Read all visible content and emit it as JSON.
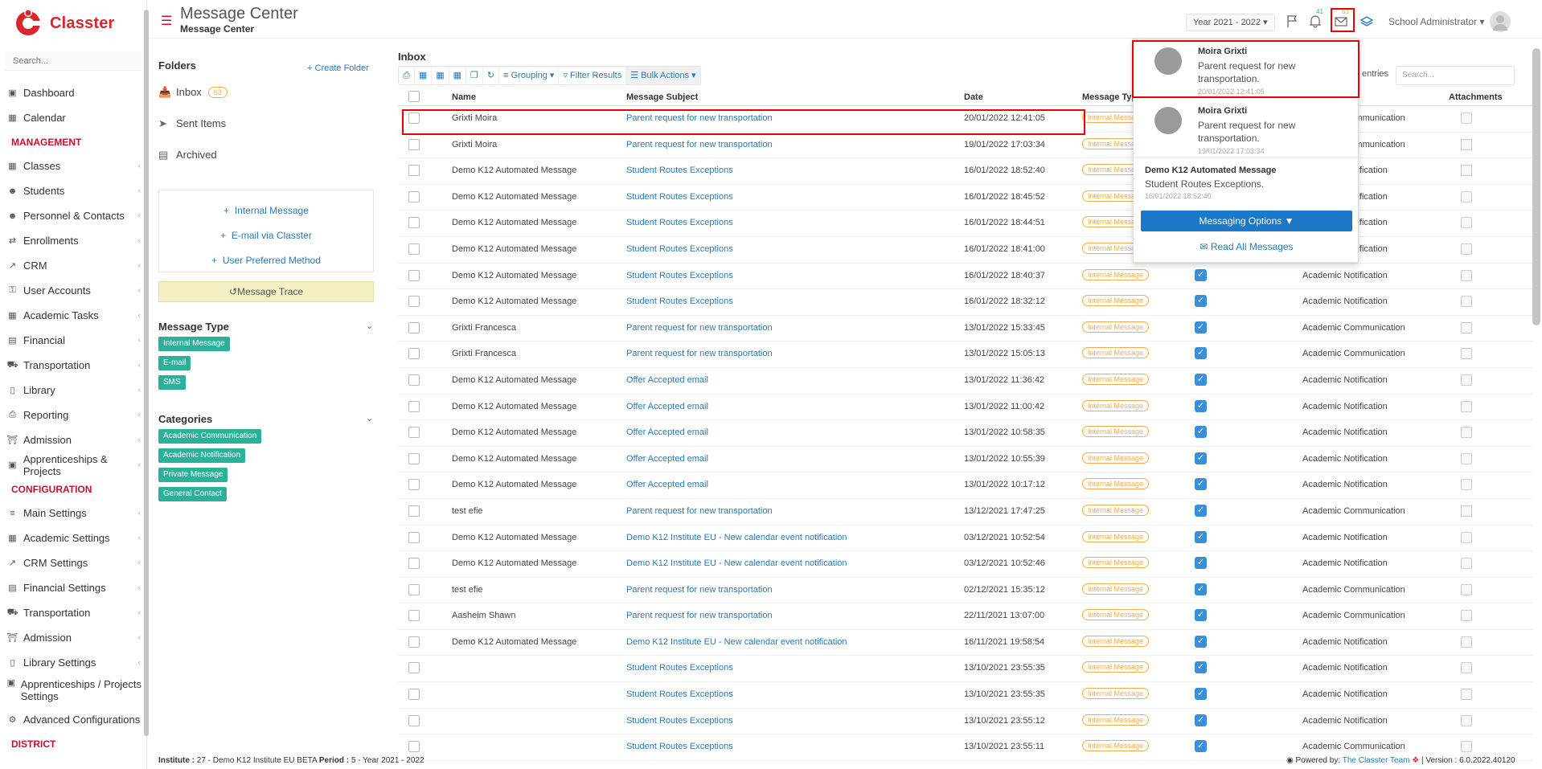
{
  "app": {
    "name": "Classter",
    "brand_color": "#d9262c"
  },
  "sidebar": {
    "search_placeholder": "Search...",
    "items": [
      {
        "type": "item",
        "label": "Dashboard",
        "icon": "laptop-icon"
      },
      {
        "type": "item",
        "label": "Calendar",
        "icon": "calendar-icon"
      },
      {
        "type": "section",
        "label": "MANAGEMENT"
      },
      {
        "type": "item",
        "label": "Classes",
        "icon": "classes-icon",
        "arrow": true
      },
      {
        "type": "item",
        "label": "Students",
        "icon": "students-icon",
        "arrow": true
      },
      {
        "type": "item",
        "label": "Personnel & Contacts",
        "icon": "personnel-icon",
        "arrow": true
      },
      {
        "type": "item",
        "label": "Enrollments",
        "icon": "enrollments-icon",
        "arrow": true
      },
      {
        "type": "item",
        "label": "CRM",
        "icon": "crm-icon",
        "arrow": true
      },
      {
        "type": "item",
        "label": "User Accounts",
        "icon": "key-icon",
        "arrow": true
      },
      {
        "type": "item",
        "label": "Academic Tasks",
        "icon": "tasks-icon",
        "arrow": true
      },
      {
        "type": "item",
        "label": "Financial",
        "icon": "money-icon",
        "arrow": true
      },
      {
        "type": "item",
        "label": "Transportation",
        "icon": "bus-icon",
        "arrow": true
      },
      {
        "type": "item",
        "label": "Library",
        "icon": "library-icon",
        "arrow": true
      },
      {
        "type": "item",
        "label": "Reporting",
        "icon": "printer-icon",
        "arrow": true
      },
      {
        "type": "item",
        "label": "Admission",
        "icon": "building-icon",
        "arrow": true
      },
      {
        "type": "item",
        "label": "Apprenticeships & Projects",
        "icon": "cube-icon",
        "arrow": true
      },
      {
        "type": "section",
        "label": "CONFIGURATION"
      },
      {
        "type": "item",
        "label": "Main Settings",
        "icon": "sliders-icon",
        "arrow": true
      },
      {
        "type": "item",
        "label": "Academic Settings",
        "icon": "classes-icon",
        "arrow": true
      },
      {
        "type": "item",
        "label": "CRM Settings",
        "icon": "crm-icon",
        "arrow": true
      },
      {
        "type": "item",
        "label": "Financial Settings",
        "icon": "money-icon",
        "arrow": true
      },
      {
        "type": "item",
        "label": "Transportation",
        "icon": "bus-icon",
        "arrow": true
      },
      {
        "type": "item",
        "label": "Admission",
        "icon": "building-icon",
        "arrow": true
      },
      {
        "type": "item",
        "label": "Library Settings",
        "icon": "library-icon",
        "arrow": true
      },
      {
        "type": "item2",
        "label": "Apprenticeships / Projects Settings",
        "icon": "cube-icon",
        "arrow": true
      },
      {
        "type": "item",
        "label": "Advanced Configurations",
        "icon": "gear-icon",
        "arrow": true
      },
      {
        "type": "section",
        "label": "DISTRICT"
      }
    ]
  },
  "header": {
    "title": "Message Center",
    "subtitle": "Message Center",
    "year": "Year 2021 - 2022",
    "notif_count": "41",
    "message_count": "63",
    "user": "School Administrator"
  },
  "folders": {
    "title": "Folders",
    "create": "Create Folder",
    "inbox": "Inbox",
    "inbox_count": "63",
    "sent": "Sent Items",
    "archived": "Archived",
    "internal": "Internal Message",
    "email": "E-mail via Classter",
    "preferred": "User Preferred Method",
    "trace": "Message Trace",
    "message_type_title": "Message Type",
    "message_types": [
      "Internal Message",
      "E-mail",
      "SMS"
    ],
    "categories_title": "Categories",
    "categories": [
      "Academic Communication",
      "Academic Notification",
      "Private Message",
      "General Contact"
    ]
  },
  "inbox": {
    "title": "Inbox",
    "toolbar": {
      "grouping": "Grouping",
      "filter": "Filter Results",
      "bulk": "Bulk Actions"
    },
    "entries_label": "entries",
    "search_placeholder": "Search...",
    "columns": {
      "name": "Name",
      "subject": "Message Subject",
      "date": "Date",
      "type": "Message Typ",
      "attachments": "Attachments"
    },
    "rows": [
      {
        "name": "Grixti Moira",
        "subject": "Parent request for new transportation",
        "date": "20/01/2022 12:41:05",
        "type": "Internal Message",
        "category": "Academic Communication",
        "checked": false
      },
      {
        "name": "Grixti Moira",
        "subject": "Parent request for new transportation",
        "date": "19/01/2022 17:03:34",
        "type": "Internal Message",
        "category": "Academic Communication",
        "checked": false
      },
      {
        "name": "Demo K12 Automated Message",
        "subject": "Student Routes Exceptions",
        "date": "16/01/2022 18:52:40",
        "type": "Internal Message",
        "category": "Academic Notification",
        "checked": false
      },
      {
        "name": "Demo K12 Automated Message",
        "subject": "Student Routes Exceptions",
        "date": "16/01/2022 18:45:52",
        "type": "Internal Message",
        "category": "Academic Notification",
        "checked": false
      },
      {
        "name": "Demo K12 Automated Message",
        "subject": "Student Routes Exceptions",
        "date": "16/01/2022 18:44:51",
        "type": "Internal Message",
        "category": "Academic Notification",
        "checked": false
      },
      {
        "name": "Demo K12 Automated Message",
        "subject": "Student Routes Exceptions",
        "date": "16/01/2022 18:41:00",
        "type": "Internal Message",
        "category": "Academic Notification",
        "checked": false
      },
      {
        "name": "Demo K12 Automated Message",
        "subject": "Student Routes Exceptions",
        "date": "16/01/2022 18:40:37",
        "type": "Internal Message",
        "category": "Academic Notification",
        "checked": true
      },
      {
        "name": "Demo K12 Automated Message",
        "subject": "Student Routes Exceptions",
        "date": "16/01/2022 18:32:12",
        "type": "Internal Message",
        "category": "Academic Notification",
        "checked": true
      },
      {
        "name": "Grixti Francesca",
        "subject": "Parent request for new transportation",
        "date": "13/01/2022 15:33:45",
        "type": "Internal Message",
        "category": "Academic Communication",
        "checked": true
      },
      {
        "name": "Grixti Francesca",
        "subject": "Parent request for new transportation",
        "date": "13/01/2022 15:05:13",
        "type": "Internal Message",
        "category": "Academic Communication",
        "checked": true
      },
      {
        "name": "Demo K12 Automated Message",
        "subject": "Offer Accepted email",
        "date": "13/01/2022 11:36:42",
        "type": "Internal Message",
        "category": "Academic Notification",
        "checked": true
      },
      {
        "name": "Demo K12 Automated Message",
        "subject": "Offer Accepted email",
        "date": "13/01/2022 11:00:42",
        "type": "Internal Message",
        "category": "Academic Notification",
        "checked": true
      },
      {
        "name": "Demo K12 Automated Message",
        "subject": "Offer Accepted email",
        "date": "13/01/2022 10:58:35",
        "type": "Internal Message",
        "category": "Academic Notification",
        "checked": true
      },
      {
        "name": "Demo K12 Automated Message",
        "subject": "Offer Accepted email",
        "date": "13/01/2022 10:55:39",
        "type": "Internal Message",
        "category": "Academic Notification",
        "checked": true
      },
      {
        "name": "Demo K12 Automated Message",
        "subject": "Offer Accepted email",
        "date": "13/01/2022 10:17:12",
        "type": "Internal Message",
        "category": "Academic Notification",
        "checked": true
      },
      {
        "name": "test efie",
        "subject": "Parent request for new transportation",
        "date": "13/12/2021 17:47:25",
        "type": "Internal Message",
        "category": "Academic Communication",
        "checked": true
      },
      {
        "name": "Demo K12 Automated Message",
        "subject": "Demo K12 Institute EU - New calendar event notification",
        "date": "03/12/2021 10:52:54",
        "type": "Internal Message",
        "category": "Academic Notification",
        "checked": true
      },
      {
        "name": "Demo K12 Automated Message",
        "subject": "Demo K12 Institute EU - New calendar event notification",
        "date": "03/12/2021 10:52:46",
        "type": "Internal Message",
        "category": "Academic Notification",
        "checked": true
      },
      {
        "name": "test efie",
        "subject": "Parent request for new transportation",
        "date": "02/12/2021 15:35:12",
        "type": "Internal Message",
        "category": "Academic Communication",
        "checked": true
      },
      {
        "name": "Aasheim Shawn",
        "subject": "Parent request for new transportation",
        "date": "22/11/2021 13:07:00",
        "type": "Internal Message",
        "category": "Academic Communication",
        "checked": true
      },
      {
        "name": "Demo K12 Automated Message",
        "subject": "Demo K12 Institute EU - New calendar event notification",
        "date": "16/11/2021 19:58:54",
        "type": "Internal Message",
        "category": "Academic Notification",
        "checked": true
      },
      {
        "name": "",
        "subject": "Student Routes Exceptions",
        "date": "13/10/2021 23:55:35",
        "type": "Internal Message",
        "category": "Academic Notification",
        "checked": true
      },
      {
        "name": "",
        "subject": "Student Routes Exceptions",
        "date": "13/10/2021 23:55:35",
        "type": "Internal Message",
        "category": "Academic Notification",
        "checked": true
      },
      {
        "name": "",
        "subject": "Student Routes Exceptions",
        "date": "13/10/2021 23:55:12",
        "type": "Internal Message",
        "category": "Academic Notification",
        "checked": true
      },
      {
        "name": "",
        "subject": "Student Routes Exceptions",
        "date": "13/10/2021 23:55:11",
        "type": "Internal Message",
        "category": "Academic Communication",
        "checked": true
      }
    ]
  },
  "dropdown": {
    "messages": [
      {
        "name": "Moira Grixti",
        "text": "Parent request for new transportation.",
        "time": "20/01/2022 12:41:05"
      },
      {
        "name": "Moira Grixti",
        "text": "Parent request for new transportation.",
        "time": "19/01/2022 17:03:34"
      },
      {
        "name": "Demo K12 Automated Message",
        "text": "Student Routes Exceptions.",
        "time": "16/01/2022 18:52:40"
      }
    ],
    "options": "Messaging Options",
    "read_all": "Read All Messages"
  },
  "footer": {
    "institute_label": "Institute :",
    "institute": "27 - Demo K12 Institute EU BETA",
    "period_label": "Period :",
    "period": "5 - Year 2021 - 2022",
    "powered": "Powered by:",
    "team": "The Classter Team",
    "version": "| Version : 6.0.2022.40120"
  }
}
